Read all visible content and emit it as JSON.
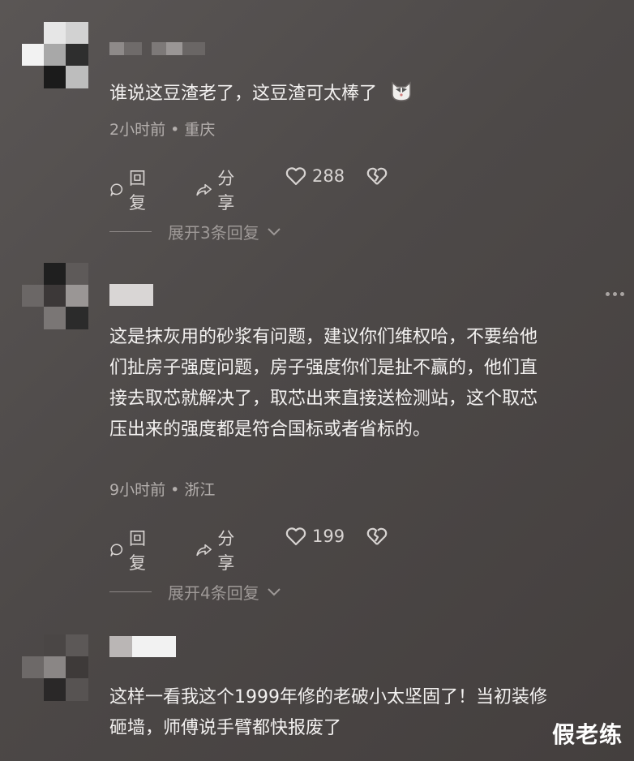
{
  "comments": [
    {
      "text": "谁说这豆渣老了，这豆渣可太棒了",
      "meta": "2小时前 • 重庆",
      "reply": "回复",
      "share": "分享",
      "likes": "288",
      "expand": "展开3条回复"
    },
    {
      "lines": [
        "这是抹灰用的砂浆有问题，建议你们维权哈，不要给他",
        "们扯房子强度问题，房子强度你们是扯不赢的，他们直",
        "接去取芯就解决了，取芯出来直接送检测站，这个取芯",
        "压出来的强度都是符合国标或者省标的。"
      ],
      "meta": "9小时前 • 浙江",
      "reply": "回复",
      "share": "分享",
      "likes": "199",
      "expand": "展开4条回复"
    },
    {
      "lines": [
        "这样一看我这个1999年修的老破小太坚固了！当初装修",
        "砸墙，师傅说手臂都快报废了"
      ]
    }
  ],
  "watermark": "假老练",
  "icons": {
    "reply": "comment-bubble-icon",
    "share": "share-arrow-icon",
    "like": "heart-icon",
    "dislike": "broken-heart-icon",
    "emoji": "cat-face-emoji-icon",
    "more": "more-dots-icon",
    "chevron": "chevron-down-icon"
  }
}
